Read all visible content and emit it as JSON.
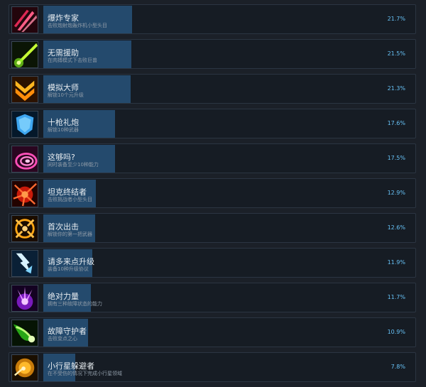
{
  "achievements": [
    {
      "title": "爆炸专家",
      "desc": "击败炮射炮轰炸机小型头目",
      "percent": "21.7%",
      "value": 21.7,
      "icon": "pink-claw-slash-icon",
      "icon_colors": [
        "#2a0710",
        "#ff4f7a"
      ]
    },
    {
      "title": "无需援助",
      "desc": "在肉搏模式下击败巨兽",
      "percent": "21.5%",
      "value": 21.5,
      "icon": "green-energy-bolt-icon",
      "icon_colors": [
        "#0c1a05",
        "#b8ff30"
      ]
    },
    {
      "title": "模拟大师",
      "desc": "解锁10个元升级",
      "percent": "21.3%",
      "value": 21.3,
      "icon": "gold-chevron-icon",
      "icon_colors": [
        "#2a1200",
        "#ffb21e"
      ]
    },
    {
      "title": "十枪礼炮",
      "desc": "解锁10种武器",
      "percent": "17.6%",
      "value": 17.6,
      "icon": "blue-crystal-shield-icon",
      "icon_colors": [
        "#041a2a",
        "#48b8ff"
      ]
    },
    {
      "title": "这够吗?",
      "desc": "同时装备至少10种能力",
      "percent": "17.5%",
      "value": 17.5,
      "icon": "pink-spiral-icon",
      "icon_colors": [
        "#2a0620",
        "#ff4fb8"
      ]
    },
    {
      "title": "坦克终结者",
      "desc": "击败挑战者小型头目",
      "percent": "12.9%",
      "value": 12.9,
      "icon": "red-explosion-icon",
      "icon_colors": [
        "#260300",
        "#ff3a1c"
      ]
    },
    {
      "title": "首次出击",
      "desc": "解锁你的第一把武器",
      "percent": "12.6%",
      "value": 12.6,
      "icon": "gold-crosshair-icon",
      "icon_colors": [
        "#1e0e00",
        "#ffa614"
      ]
    },
    {
      "title": "请多来点升级",
      "desc": "装备10种升级协议",
      "percent": "11.9%",
      "value": 11.9,
      "icon": "blue-arrow-down-icon",
      "icon_colors": [
        "#0a2036",
        "#7fd4ff"
      ]
    },
    {
      "title": "绝对力量",
      "desc": "拥有三种故障状态的能力",
      "percent": "11.7%",
      "value": 11.7,
      "icon": "purple-energy-burst-icon",
      "icon_colors": [
        "#160326",
        "#c13bff"
      ]
    },
    {
      "title": "故障守护者",
      "desc": "击败变点之心",
      "percent": "10.9%",
      "value": 10.9,
      "icon": "green-comet-icon",
      "icon_colors": [
        "#061404",
        "#5cff3c"
      ]
    },
    {
      "title": "小行星躲避者",
      "desc": "在不受伤的情况下完成小行星领域",
      "percent": "7.8%",
      "value": 7.8,
      "icon": "gold-planet-icon",
      "icon_colors": [
        "#1a0f00",
        "#ffb92a"
      ]
    }
  ]
}
